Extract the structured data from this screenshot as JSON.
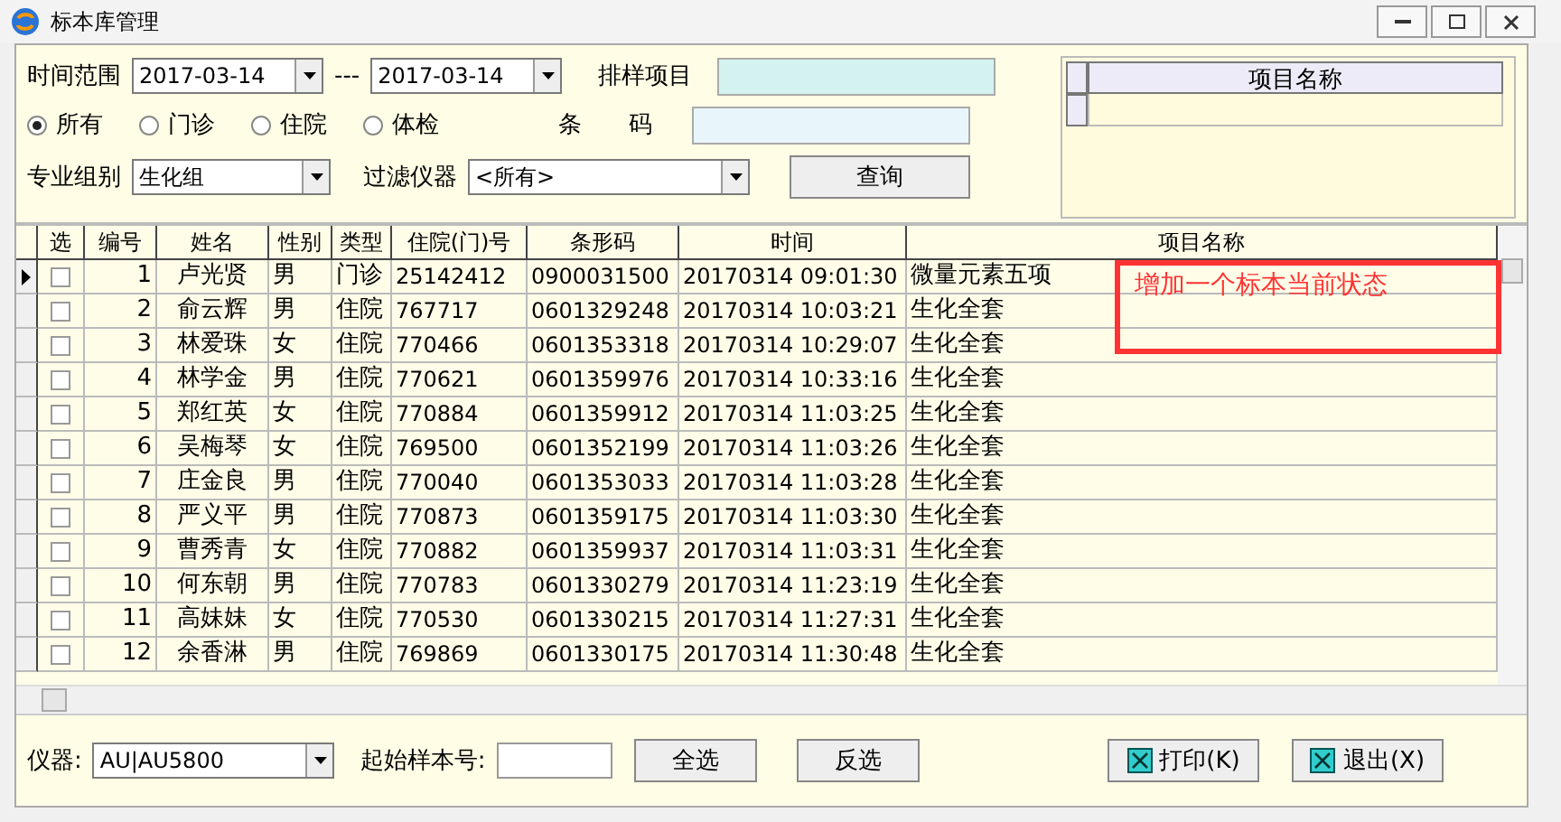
{
  "window": {
    "title": "标本库管理"
  },
  "filters": {
    "time_label": "时间范围",
    "date_from": "2017-03-14",
    "separator": "---",
    "date_to": "2017-03-14",
    "sample_item_label": "排样项目",
    "barcode_label": "条　　码",
    "group_label": "专业组别",
    "group_value": "生化组",
    "instrument_filter_label": "过滤仪器",
    "instrument_filter_value": "<所有>",
    "query_button": "查询",
    "patient_types": [
      {
        "label": "所有",
        "selected": true
      },
      {
        "label": "门诊",
        "selected": false
      },
      {
        "label": "住院",
        "selected": false
      },
      {
        "label": "体检",
        "selected": false
      }
    ]
  },
  "item_panel": {
    "columns": [
      "项目名称"
    ]
  },
  "table": {
    "check_column": "选",
    "columns": [
      "编号",
      "姓名",
      "性别",
      "类型",
      "住院(门)号",
      "条形码",
      "时间",
      "项目名称"
    ],
    "rows": [
      {
        "current": true,
        "checked": false,
        "cells": [
          "1",
          "卢光贤",
          "男",
          "门诊",
          "25142412",
          "0900031500",
          "20170314 09:01:30",
          "微量元素五项"
        ]
      },
      {
        "current": false,
        "checked": false,
        "cells": [
          "2",
          "俞云辉",
          "男",
          "住院",
          "767717",
          "0601329248",
          "20170314 10:03:21",
          "生化全套"
        ]
      },
      {
        "current": false,
        "checked": false,
        "cells": [
          "3",
          "林爱珠",
          "女",
          "住院",
          "770466",
          "0601353318",
          "20170314 10:29:07",
          "生化全套"
        ]
      },
      {
        "current": false,
        "checked": false,
        "cells": [
          "4",
          "林学金",
          "男",
          "住院",
          "770621",
          "0601359976",
          "20170314 10:33:16",
          "生化全套"
        ]
      },
      {
        "current": false,
        "checked": false,
        "cells": [
          "5",
          "郑红英",
          "女",
          "住院",
          "770884",
          "0601359912",
          "20170314 11:03:25",
          "生化全套"
        ]
      },
      {
        "current": false,
        "checked": false,
        "cells": [
          "6",
          "吴梅琴",
          "女",
          "住院",
          "769500",
          "0601352199",
          "20170314 11:03:26",
          "生化全套"
        ]
      },
      {
        "current": false,
        "checked": false,
        "cells": [
          "7",
          "庄金良",
          "男",
          "住院",
          "770040",
          "0601353033",
          "20170314 11:03:28",
          "生化全套"
        ]
      },
      {
        "current": false,
        "checked": false,
        "cells": [
          "8",
          "严义平",
          "男",
          "住院",
          "770873",
          "0601359175",
          "20170314 11:03:30",
          "生化全套"
        ]
      },
      {
        "current": false,
        "checked": false,
        "cells": [
          "9",
          "曹秀青",
          "女",
          "住院",
          "770882",
          "0601359937",
          "20170314 11:03:31",
          "生化全套"
        ]
      },
      {
        "current": false,
        "checked": false,
        "cells": [
          "10",
          "何东朝",
          "男",
          "住院",
          "770783",
          "0601330279",
          "20170314 11:23:19",
          "生化全套"
        ]
      },
      {
        "current": false,
        "checked": false,
        "cells": [
          "11",
          "高妹妹",
          "女",
          "住院",
          "770530",
          "0601330215",
          "20170314 11:27:31",
          "生化全套"
        ]
      },
      {
        "current": false,
        "checked": false,
        "cells": [
          "12",
          "余香淋",
          "男",
          "住院",
          "769869",
          "0601330175",
          "20170314 11:30:48",
          "生化全套"
        ]
      }
    ]
  },
  "annotation": {
    "text": "增加一个标本当前状态"
  },
  "footer": {
    "instrument_label": "仪器:",
    "instrument_value": "AU|AU5800",
    "start_no_label": "起始样本号:",
    "select_all": "全选",
    "invert": "反选",
    "print": "打印(K)",
    "exit": "退出(X)"
  }
}
